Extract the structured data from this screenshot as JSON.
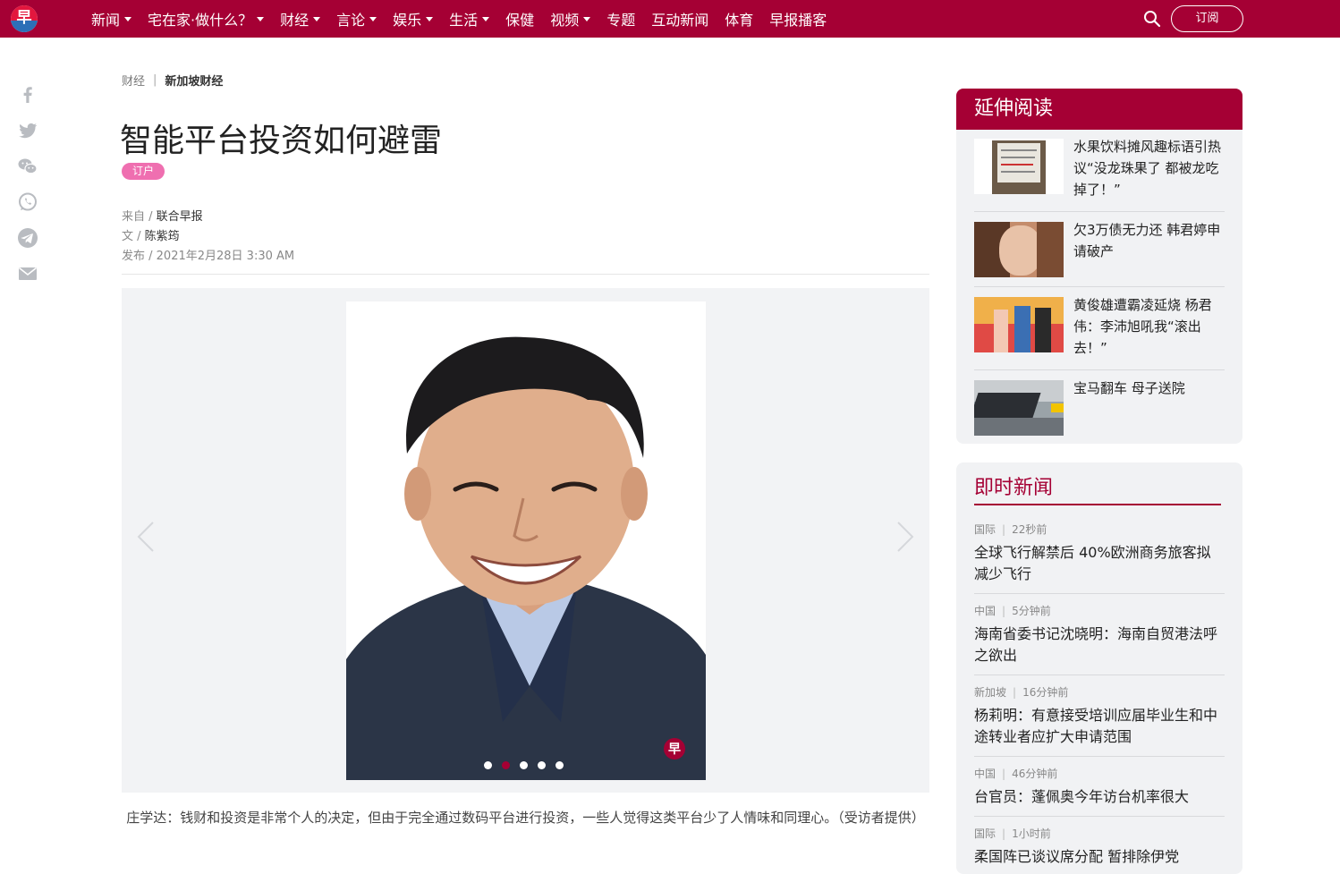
{
  "nav": {
    "items": [
      {
        "label": "新闻",
        "dropdown": true
      },
      {
        "label": "宅在家·做什么？",
        "dropdown": true
      },
      {
        "label": "财经",
        "dropdown": true
      },
      {
        "label": "言论",
        "dropdown": true
      },
      {
        "label": "娱乐",
        "dropdown": true
      },
      {
        "label": "生活",
        "dropdown": true
      },
      {
        "label": "保健",
        "dropdown": false
      },
      {
        "label": "视频",
        "dropdown": true
      },
      {
        "label": "专题",
        "dropdown": false
      },
      {
        "label": "互动新闻",
        "dropdown": false
      },
      {
        "label": "体育",
        "dropdown": false
      },
      {
        "label": "早报播客",
        "dropdown": false
      }
    ],
    "logo_char": "早",
    "subscribe_label": "订阅",
    "search_icon": "search-icon"
  },
  "share": {
    "icons": [
      "facebook-icon",
      "twitter-icon",
      "wechat-icon",
      "whatsapp-icon",
      "telegram-icon",
      "email-icon"
    ]
  },
  "article": {
    "breadcrumb": {
      "parent": "财经",
      "separator": "|",
      "current": "新加坡财经"
    },
    "title": "智能平台投资如何避雷",
    "badge": "订户",
    "source_label": "来自 / ",
    "source": "联合早报",
    "author_label": "文 / ",
    "author": "陈紫筠",
    "published_label": "发布 / ",
    "published": "2021年2月28日 3:30 AM",
    "caption": "庄学达：钱财和投资是非常个人的决定，但由于完全通过数码平台进行投资，一些人觉得这类平台少了人情味和同理心。（受访者提供）",
    "slides_total": 5,
    "slide_active": 2
  },
  "related": {
    "title": "延伸阅读",
    "items": [
      {
        "text": "水果饮料摊风趣标语引热议“没龙珠果了 都被龙吃掉了！”"
      },
      {
        "text": "欠3万债无力还 韩君婷申请破产"
      },
      {
        "text": "黄俊雄遭霸凌延烧 杨君伟：李沛旭吼我“滚出去！”"
      },
      {
        "text": "宝马翻车 母子送院"
      }
    ]
  },
  "latest": {
    "title": "即时新闻",
    "items": [
      {
        "cat": "国际",
        "time": "22秒前",
        "headline": "全球飞行解禁后 40%欧洲商务旅客拟减少飞行"
      },
      {
        "cat": "中国",
        "time": "5分钟前",
        "headline": "海南省委书记沈晓明：海南自贸港法呼之欲出"
      },
      {
        "cat": "新加坡",
        "time": "16分钟前",
        "headline": "杨莉明：有意接受培训应届毕业生和中途转业者应扩大申请范围"
      },
      {
        "cat": "中国",
        "time": "46分钟前",
        "headline": "台官员：蓬佩奥今年访台机率很大"
      },
      {
        "cat": "国际",
        "time": "1小时前",
        "headline": "柔国阵已谈议席分配 暂排除伊党"
      }
    ]
  },
  "colors": {
    "brand": "#a50034",
    "badge": "#ef6fb0",
    "panel_bg": "#f1f2f4"
  }
}
